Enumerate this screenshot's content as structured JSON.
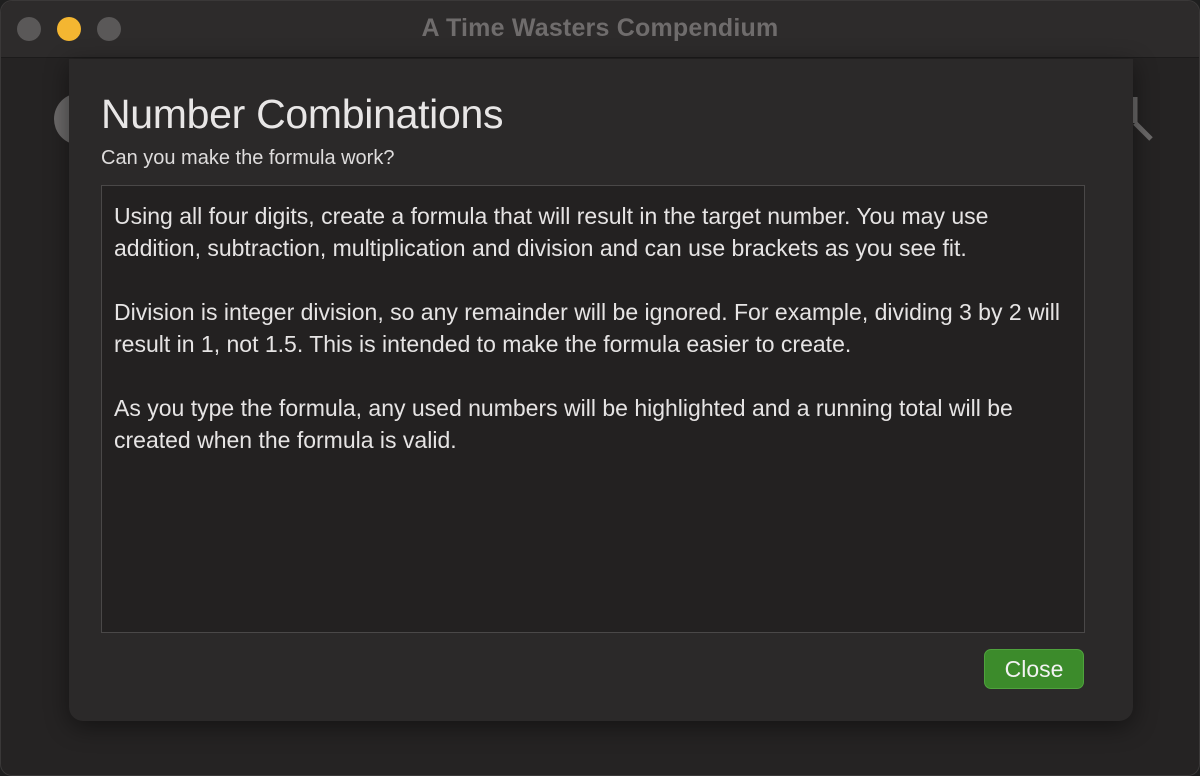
{
  "window": {
    "title": "A Time Wasters Compendium"
  },
  "dialog": {
    "title": "Number Combinations",
    "subtitle": "Can you make the formula work?",
    "paragraphs": [
      "Using all four digits, create a formula that will result in the target number. You may use addition, subtraction, multiplication and division and can use brackets as you see fit.",
      "Division is integer division, so any remainder will be ignored. For example, dividing 3 by 2 will result in 1, not 1.5. This is intended to make the formula easier to create.",
      "As you type the formula, any used numbers will be highlighted and a running total will be created when the formula is valid."
    ],
    "close_label": "Close"
  },
  "colors": {
    "accent_button": "#3c8b2b",
    "minimize_light": "#f4b631"
  },
  "icons": {
    "window_controls": [
      "close-icon",
      "minimize-icon",
      "zoom-icon"
    ]
  }
}
